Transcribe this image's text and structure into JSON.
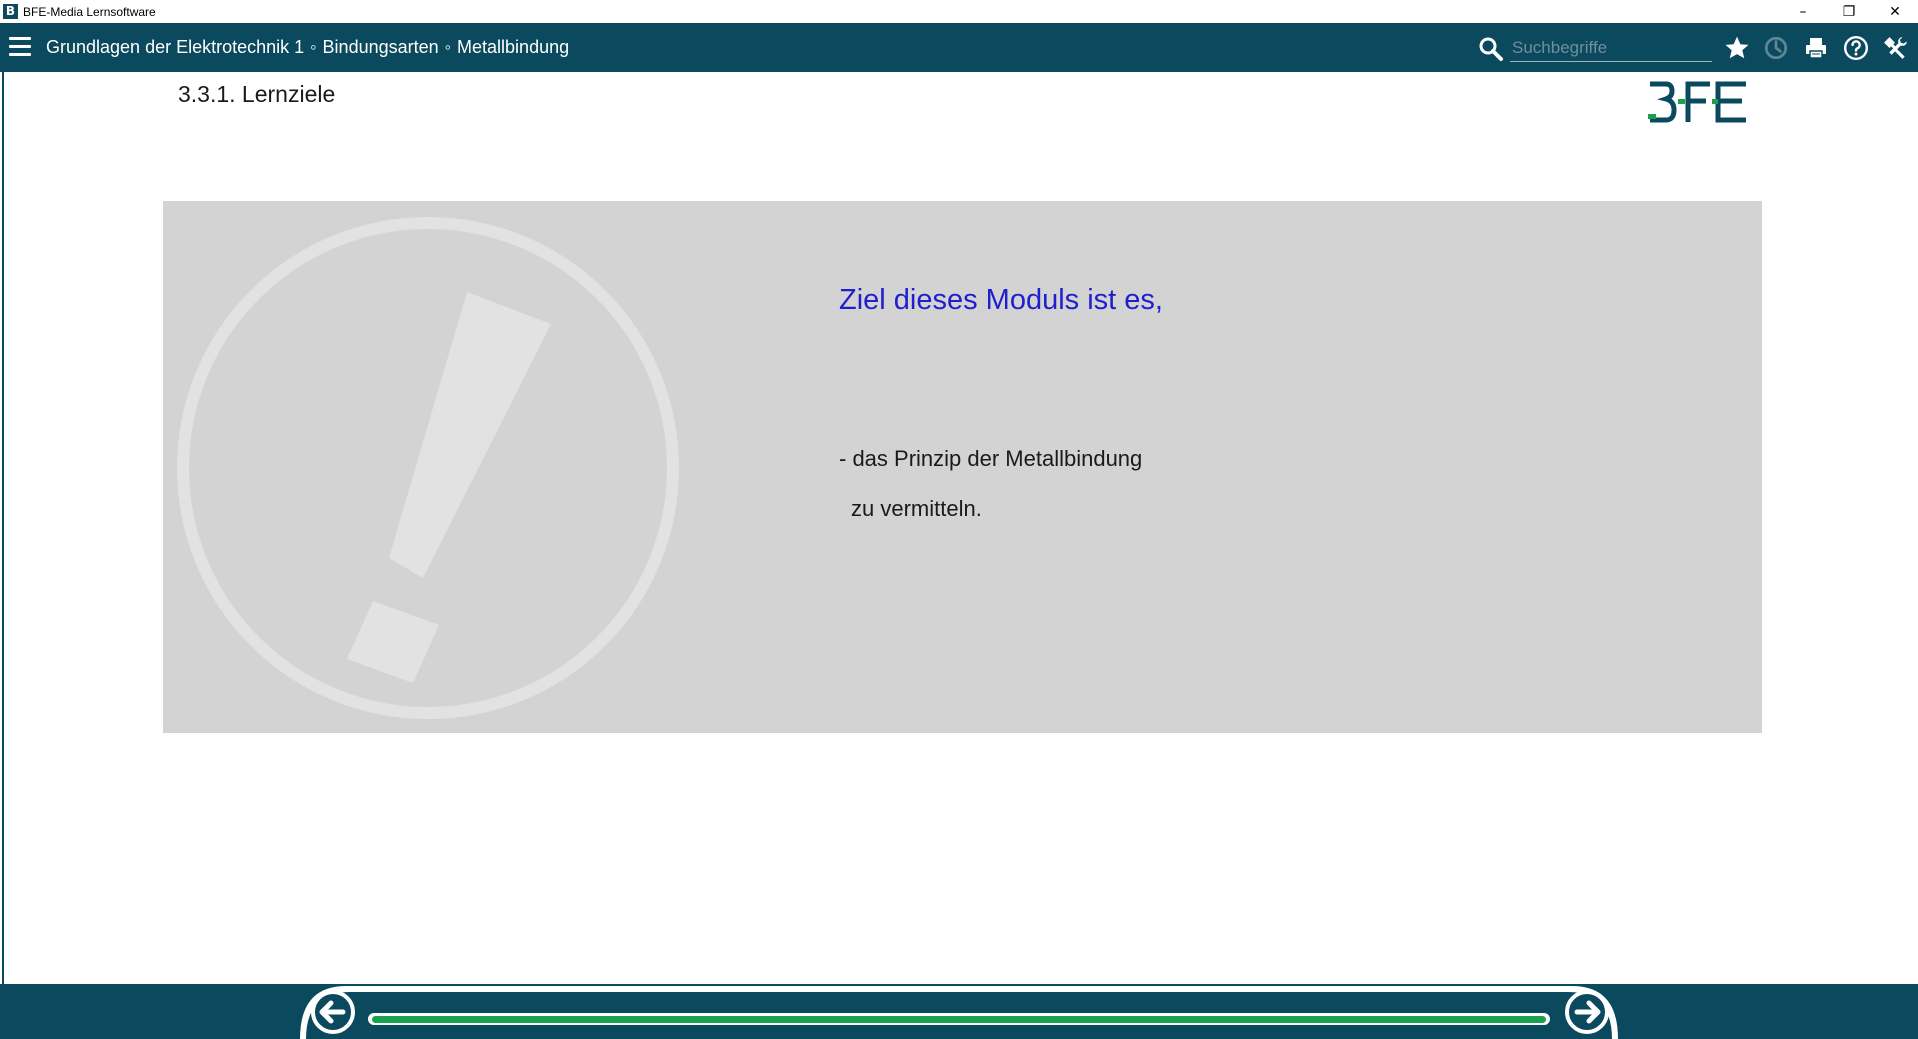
{
  "window": {
    "app_icon_letter": "B",
    "title": "BFE-Media Lernsoftware",
    "minimize_glyph": "–",
    "restore_glyph": "❐",
    "close_glyph": "✕"
  },
  "header": {
    "breadcrumb": [
      "Grundlagen der Elektrotechnik 1",
      "Bindungsarten",
      "Metallbindung"
    ],
    "breadcrumb_separator": "◦",
    "search_placeholder": "Suchbegriffe",
    "icons": [
      "menu-icon",
      "search-icon",
      "star-icon",
      "history-icon",
      "print-icon",
      "help-icon",
      "tools-icon"
    ]
  },
  "page": {
    "title": "3.3.1. Lernziele",
    "logo_text": "BFE"
  },
  "panel": {
    "heading": "Ziel dieses Moduls ist es,",
    "line1": "- das Prinzip der Metallbindung",
    "line2": "zu vermitteln."
  },
  "navigation": {
    "progress_fraction": 1.0
  },
  "colors": {
    "header_bg": "#0b4a5e",
    "heading_blue": "#1f1fd0",
    "panel_bg": "#d3d3d3",
    "progress_green": "#1aa04f",
    "logo_green": "#1aa04f"
  }
}
